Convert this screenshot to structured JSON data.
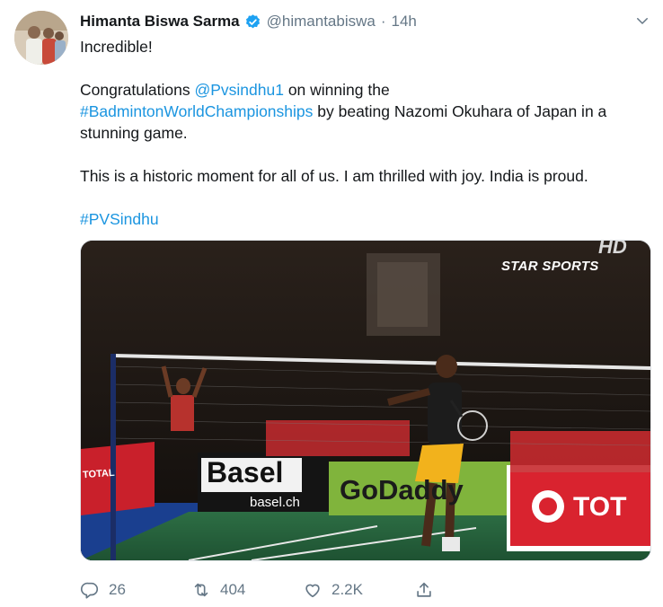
{
  "tweet": {
    "author_name": "Himanta Biswa Sarma",
    "handle": "@himantabiswa",
    "separator": "·",
    "time": "14h",
    "line1": "Incredible!",
    "para2_a": "Congratulations ",
    "para2_mention": "@Pvsindhu1",
    "para2_b": " on winning the",
    "para2_hashtag": "#BadmintonWorldChampionships",
    "para2_c": " by beating Nazomi Okuhara of Japan in a stunning game.",
    "para3": "This is a historic moment for all of us. I am thrilled with joy. India is proud.",
    "hashtag_final": "#PVSindhu"
  },
  "media": {
    "broadcaster": "STAR SPORTS",
    "hd_mark": "HD",
    "ad_basel": "Basel",
    "ad_basel_url": "basel.ch",
    "ad_godaddy": "GoDaddy",
    "ad_total": "TOT",
    "ad_total_left": "TOTAL"
  },
  "actions": {
    "replies": "26",
    "retweets": "404",
    "likes": "2.2K"
  },
  "colors": {
    "link": "#1b95e0",
    "verified": "#1da1f2",
    "muted": "#657786",
    "court_green": "#2a7a47",
    "ad_red": "#d9232f",
    "godaddy_green": "#80b43c"
  },
  "icons": [
    "verified-icon",
    "chevron-down-icon",
    "reply-icon",
    "retweet-icon",
    "like-icon",
    "share-icon"
  ]
}
